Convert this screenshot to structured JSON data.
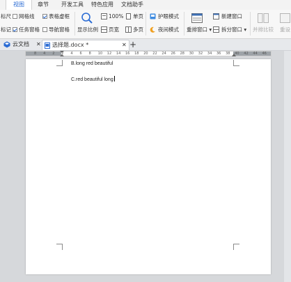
{
  "menu": {
    "tabs": [
      "视图",
      "章节",
      "开发工具",
      "特色应用",
      "文档助手"
    ],
    "active": 0
  },
  "ribbon": {
    "cut_left_top": "标尺",
    "cut_left_bottom": "标记",
    "gridlines": "网格线",
    "table_dotted": "表格虚框",
    "task_pane": "任务窗格",
    "nav_pane": "导航窗格",
    "zoom_label": "显示比例",
    "zoom_percent": "100%",
    "page_width": "页宽",
    "single_page": "单页",
    "multi_page": "多页",
    "eye_mode": "护眼模式",
    "night_mode": "夜间模式",
    "arrange_window": "重排窗口",
    "new_window": "新建窗口",
    "split_window": "拆分窗口",
    "side_by_side": "并排比较",
    "cut_right": "重设"
  },
  "doc_tabs": {
    "cloud": "云文档",
    "file": "选择题.docx *",
    "add": "+"
  },
  "ruler": {
    "numbers": [
      "8",
      "4",
      "2",
      "2",
      "4",
      "6",
      "8",
      "10",
      "12",
      "14",
      "16",
      "18",
      "20",
      "22",
      "24",
      "26",
      "28",
      "30",
      "32",
      "34",
      "36",
      "38",
      "40",
      "42",
      "44",
      "46"
    ]
  },
  "document": {
    "line_b": "B.long red beautiful",
    "line_c": "C.red beautiful long"
  },
  "colors": {
    "accent": "#2b6cd4",
    "ribbon_bg": "#f7f7f7",
    "workspace_bg": "#d6d8db"
  }
}
